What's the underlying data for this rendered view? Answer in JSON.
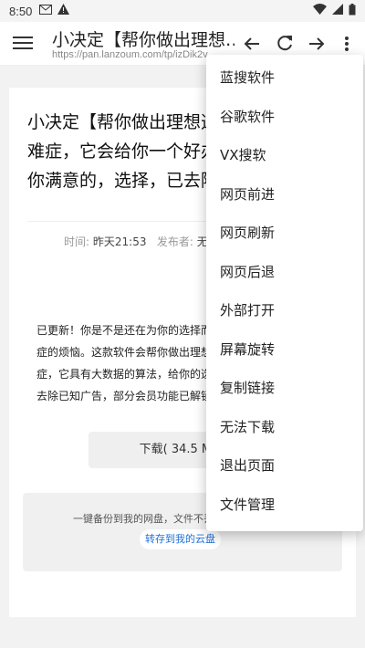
{
  "status_bar": {
    "time": "8:50"
  },
  "toolbar": {
    "title": "小决定【帮你做出理想…",
    "url": "https://pan.lanzoum.com/tp/izDik2v..."
  },
  "article": {
    "title": "小决定【帮你做出理想选择，让你摆脱选择困难症，它会给你一个好办法，给你的选择都是你满意的，选择，已去除已知广告",
    "meta_time_label": "时间:",
    "meta_time_value": "昨天21:53",
    "meta_publisher_label": "发布者:",
    "meta_publisher_value": "无名",
    "description": "已更新！你是不是还在为你的选择而纠结呢？为你解决选择困难症的烦恼。这款软件会帮你做出理想的选择，让你摆脱选择困难症，它具有大数据的算法，给你的选择都是你满意的，选择，已去除已知广告，部分会员功能已解锁。",
    "download_label": "下载( 34.5 M )",
    "save_text": "一键备份到我的网盘，文件不丢失",
    "save_link": "转存到我的云盘"
  },
  "menu": {
    "items": [
      "蓝搜软件",
      "谷歌软件",
      "VX搜软",
      "网页前进",
      "网页刷新",
      "网页后退",
      "外部打开",
      "屏幕旋转",
      "复制链接",
      "无法下载",
      "退出页面",
      "文件管理"
    ]
  },
  "colors": {
    "accent": "#1e6fd9",
    "background": "#f2f2f2"
  }
}
